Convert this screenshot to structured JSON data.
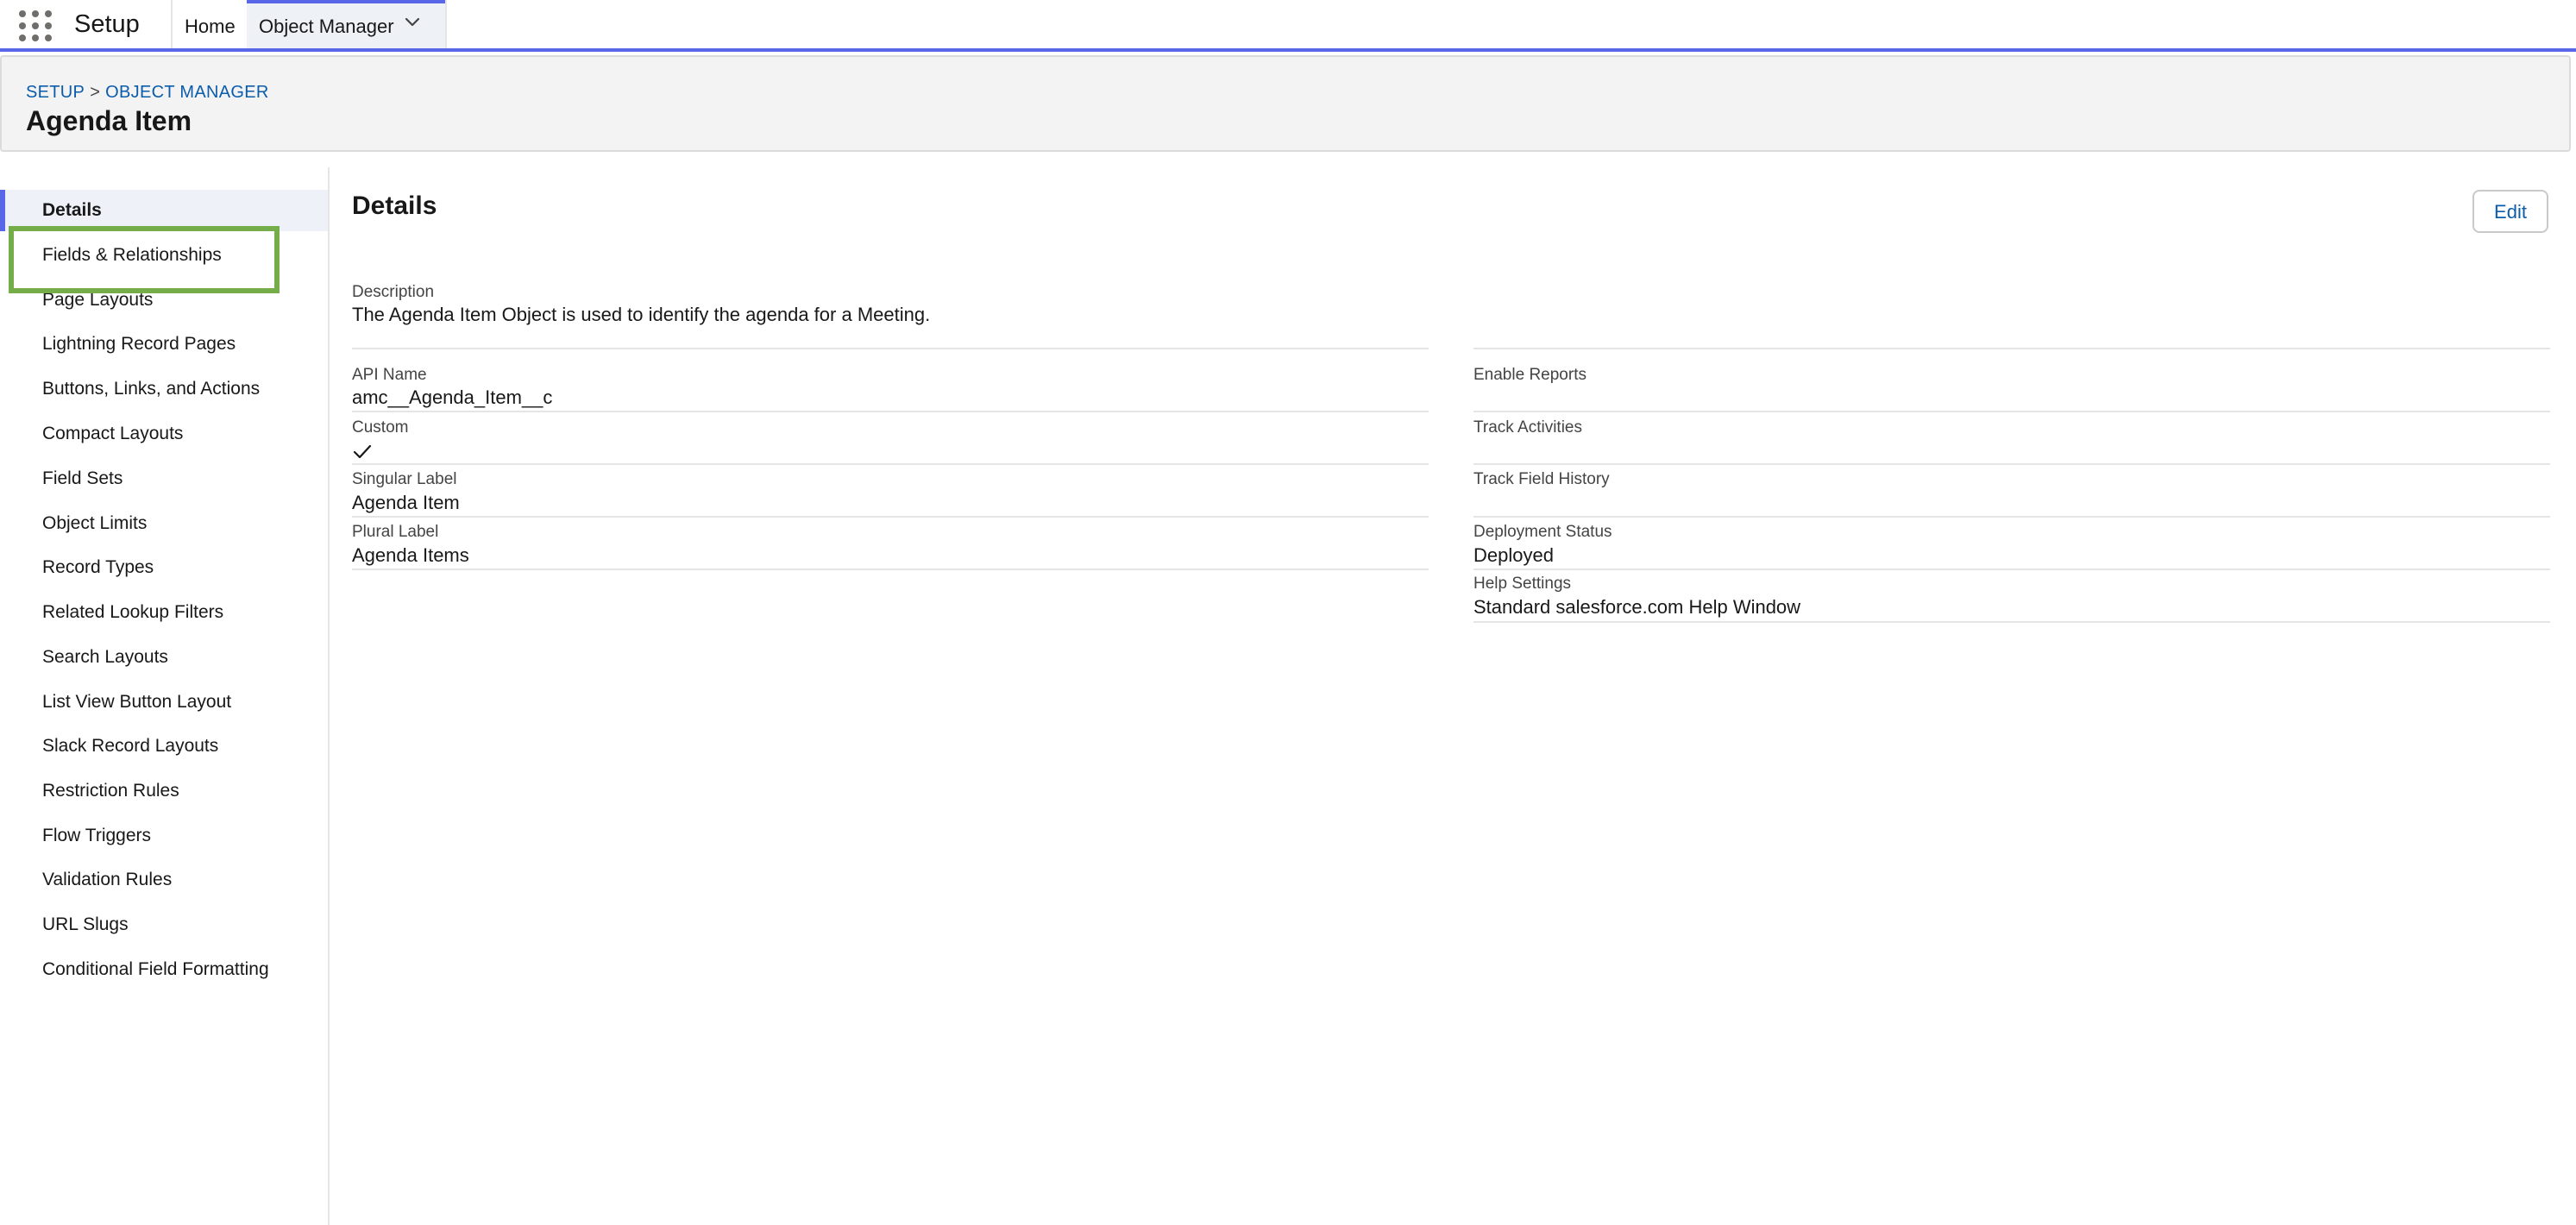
{
  "topbar": {
    "app_name": "Setup",
    "home_label": "Home",
    "active_tab_label": "Object Manager"
  },
  "header": {
    "breadcrumb_setup": "SETUP",
    "breadcrumb_sep": ">",
    "breadcrumb_object_manager": "OBJECT MANAGER",
    "title": "Agenda Item"
  },
  "sidebar": {
    "items": [
      {
        "label": "Details"
      },
      {
        "label": "Fields & Relationships"
      },
      {
        "label": "Page Layouts"
      },
      {
        "label": "Lightning Record Pages"
      },
      {
        "label": "Buttons, Links, and Actions"
      },
      {
        "label": "Compact Layouts"
      },
      {
        "label": "Field Sets"
      },
      {
        "label": "Object Limits"
      },
      {
        "label": "Record Types"
      },
      {
        "label": "Related Lookup Filters"
      },
      {
        "label": "Search Layouts"
      },
      {
        "label": "List View Button Layout"
      },
      {
        "label": "Slack Record Layouts"
      },
      {
        "label": "Restriction Rules"
      },
      {
        "label": "Flow Triggers"
      },
      {
        "label": "Validation Rules"
      },
      {
        "label": "URL Slugs"
      },
      {
        "label": "Conditional Field Formatting"
      }
    ]
  },
  "details": {
    "title": "Details",
    "edit_label": "Edit",
    "description_label": "Description",
    "description_value": "The Agenda Item Object is used to identify the agenda for a Meeting.",
    "api_name_label": "API Name",
    "api_name_value": "amc__Agenda_Item__c",
    "custom_label": "Custom",
    "custom_checked": true,
    "singular_label_label": "Singular Label",
    "singular_label_value": "Agenda Item",
    "plural_label_label": "Plural Label",
    "plural_label_value": "Agenda Items",
    "enable_reports_label": "Enable Reports",
    "track_activities_label": "Track Activities",
    "track_field_history_label": "Track Field History",
    "deployment_status_label": "Deployment Status",
    "deployment_status_value": "Deployed",
    "help_settings_label": "Help Settings",
    "help_settings_value": "Standard salesforce.com Help Window"
  },
  "colors": {
    "accent": "#5867e8",
    "link": "#0b5cab",
    "highlight": "#76ad4b"
  },
  "icons": {
    "app_launcher": "waffle-grid-icon",
    "tab_menu": "chevron-down-icon",
    "custom_checkbox": "checkmark-icon"
  }
}
